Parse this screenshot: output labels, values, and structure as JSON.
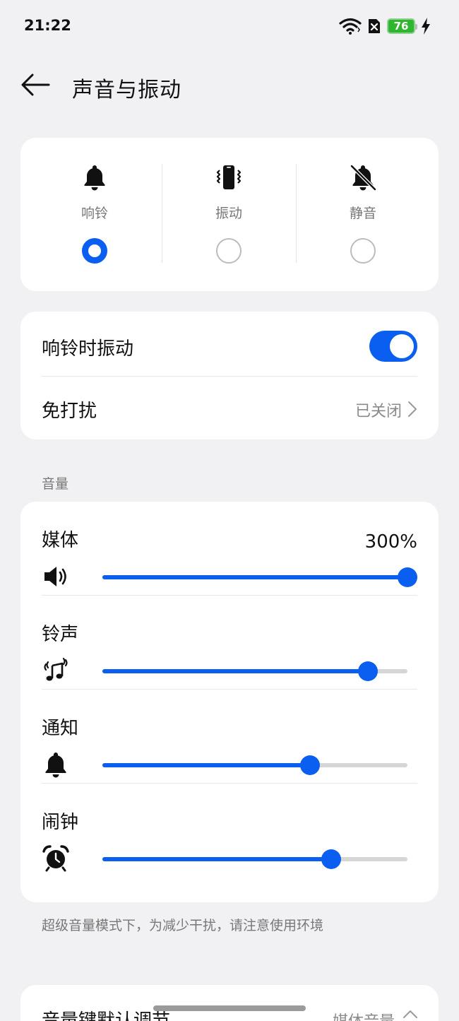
{
  "status_bar": {
    "time": "21:22",
    "battery_level": "76"
  },
  "header": {
    "title": "声音与振动"
  },
  "modes": [
    {
      "label": "响铃",
      "icon": "bell-icon",
      "selected": true
    },
    {
      "label": "振动",
      "icon": "phone-vibrate-icon",
      "selected": false
    },
    {
      "label": "静音",
      "icon": "bell-off-icon",
      "selected": false
    }
  ],
  "settings": {
    "vibrate_on_ring": {
      "label": "响铃时振动",
      "enabled": true
    },
    "do_not_disturb": {
      "label": "免打扰",
      "value": "已关闭"
    }
  },
  "volume": {
    "section_label": "音量",
    "media": {
      "label": "媒体",
      "value": "300%",
      "level": 1.0,
      "icon": "speaker-icon"
    },
    "ringtone": {
      "label": "铃声",
      "level": 0.87,
      "icon": "ringtone-music-icon"
    },
    "notification": {
      "label": "通知",
      "level": 0.68,
      "icon": "bell-icon"
    },
    "alarm": {
      "label": "闹钟",
      "level": 0.75,
      "icon": "alarm-clock-icon"
    }
  },
  "footnote": "超级音量模式下，为减少干扰，请注意使用环境",
  "volume_key": {
    "label": "音量键默认调节",
    "value": "媒体音量"
  },
  "colors": {
    "accent": "#0a5ff0",
    "background": "#f1f1f3",
    "card": "#ffffff"
  }
}
